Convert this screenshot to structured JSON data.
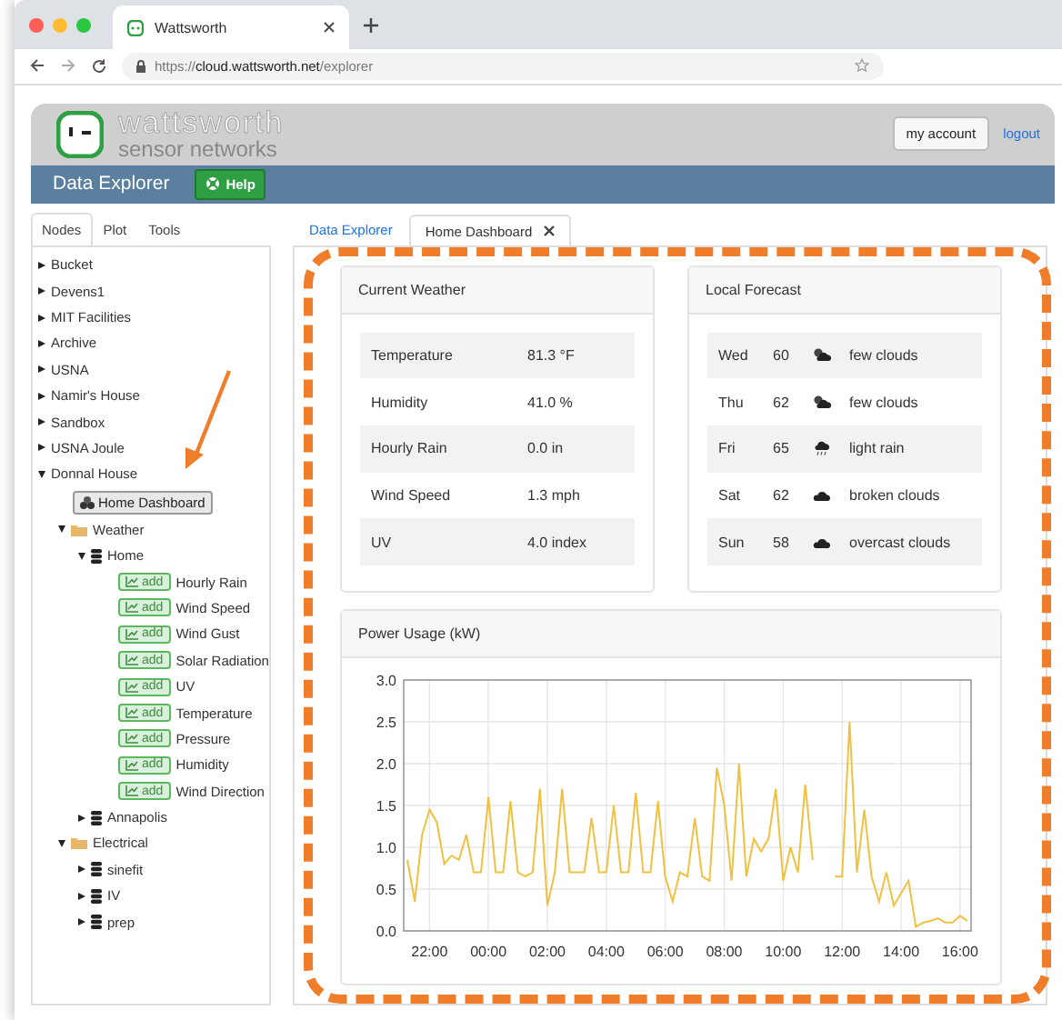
{
  "browser": {
    "tab_title": "Wattsworth",
    "url": "https://**cloud.wattsworth.net**/explorer"
  },
  "header": {
    "brand": "wattsworth",
    "tagline": "sensor networks",
    "account_button": "my account",
    "logout_link": "logout"
  },
  "toolbar": {
    "title": "Data Explorer",
    "help_button": "Help"
  },
  "sidebar": {
    "tabs": [
      {
        "label": "Nodes",
        "selected": true
      },
      {
        "label": "Plot",
        "selected": false
      },
      {
        "label": "Tools",
        "selected": false
      }
    ],
    "nodes": [
      {
        "kind": "group",
        "label": "Bucket",
        "expanded": false
      },
      {
        "kind": "group",
        "label": "Devens1",
        "expanded": false
      },
      {
        "kind": "group",
        "label": "MIT Facilities",
        "expanded": false
      },
      {
        "kind": "group",
        "label": "Archive",
        "expanded": false
      },
      {
        "kind": "group",
        "label": "USNA",
        "expanded": false
      },
      {
        "kind": "group",
        "label": "Namir's House",
        "expanded": false
      },
      {
        "kind": "group",
        "label": "Sandbox",
        "expanded": false
      },
      {
        "kind": "group",
        "label": "USNA Joule",
        "expanded": false
      },
      {
        "kind": "group",
        "label": "Donnal House",
        "expanded": true,
        "children": [
          {
            "kind": "dashboard",
            "label": "Home Dashboard"
          },
          {
            "kind": "folder",
            "label": "Weather",
            "expanded": true,
            "children": [
              {
                "kind": "module",
                "label": "Home",
                "expanded": true,
                "children": [
                  {
                    "kind": "stream",
                    "button": "add",
                    "label": "Hourly Rain"
                  },
                  {
                    "kind": "stream",
                    "button": "add",
                    "label": "Wind Speed"
                  },
                  {
                    "kind": "stream",
                    "button": "add",
                    "label": "Wind Gust"
                  },
                  {
                    "kind": "stream",
                    "button": "add",
                    "label": "Solar Radiation"
                  },
                  {
                    "kind": "stream",
                    "button": "add",
                    "label": "UV"
                  },
                  {
                    "kind": "stream",
                    "button": "add",
                    "label": "Temperature"
                  },
                  {
                    "kind": "stream",
                    "button": "add",
                    "label": "Pressure"
                  },
                  {
                    "kind": "stream",
                    "button": "add",
                    "label": "Humidity"
                  },
                  {
                    "kind": "stream",
                    "button": "add",
                    "label": "Wind Direction"
                  }
                ]
              },
              {
                "kind": "module",
                "label": "Annapolis",
                "expanded": false
              }
            ]
          },
          {
            "kind": "folder",
            "label": "Electrical",
            "expanded": true,
            "children": [
              {
                "kind": "module",
                "label": "sinefit",
                "expanded": false
              },
              {
                "kind": "module",
                "label": "IV",
                "expanded": false
              },
              {
                "kind": "module",
                "label": "prep",
                "expanded": false
              }
            ]
          }
        ]
      }
    ]
  },
  "main_tabs": [
    {
      "label": "Data Explorer",
      "selected": false,
      "closable": false
    },
    {
      "label": "Home Dashboard",
      "selected": true,
      "closable": true
    }
  ],
  "current_weather": {
    "title": "Current Weather",
    "rows": [
      {
        "name": "Temperature",
        "value": "81.3 °F"
      },
      {
        "name": "Humidity",
        "value": "41.0 %"
      },
      {
        "name": "Hourly Rain",
        "value": "0.0 in"
      },
      {
        "name": "Wind Speed",
        "value": "1.3 mph"
      },
      {
        "name": "UV",
        "value": "4.0 index"
      }
    ]
  },
  "local_forecast": {
    "title": "Local Forecast",
    "rows": [
      {
        "day": "Wed",
        "temp": "60",
        "kind": "partly-cloudy",
        "summary": "few clouds"
      },
      {
        "day": "Thu",
        "temp": "62",
        "kind": "partly-cloudy",
        "summary": "few clouds"
      },
      {
        "day": "Fri",
        "temp": "65",
        "kind": "rain",
        "summary": "light rain"
      },
      {
        "day": "Sat",
        "temp": "62",
        "kind": "cloudy",
        "summary": "broken clouds"
      },
      {
        "day": "Sun",
        "temp": "58",
        "kind": "cloudy",
        "summary": "overcast clouds"
      }
    ]
  },
  "power_usage": {
    "title": "Power Usage (kW)",
    "chart_data": {
      "type": "line",
      "grid": true,
      "ylim": [
        0,
        3
      ],
      "categories": [
        null,
        null,
        null,
        "22:00",
        null,
        null,
        null,
        null,
        null,
        null,
        null,
        "00:00",
        null,
        null,
        null,
        null,
        null,
        null,
        null,
        "02:00",
        null,
        null,
        null,
        null,
        null,
        null,
        null,
        "04:00",
        null,
        null,
        null,
        null,
        null,
        null,
        null,
        "06:00",
        null,
        null,
        null,
        null,
        null,
        null,
        null,
        "08:00",
        null,
        null,
        null,
        null,
        null,
        null,
        null,
        "10:00",
        null,
        null,
        null,
        null,
        null,
        null,
        null,
        "12:00",
        null,
        null,
        null,
        null,
        null,
        null,
        null,
        "14:00",
        null,
        null,
        null,
        null,
        null,
        null,
        null,
        "16:00",
        null
      ],
      "yticks": [
        {
          "value": 0,
          "label": "0.0"
        },
        {
          "value": 0.5,
          "label": "0.5"
        },
        {
          "value": 1,
          "label": "1.0"
        },
        {
          "value": 1.5,
          "label": "1.5"
        },
        {
          "value": 2,
          "label": "2.0"
        },
        {
          "value": 2.5,
          "label": "2.5"
        },
        {
          "value": 3,
          "label": "3.0"
        }
      ],
      "series": [
        {
          "color": "#f0c040",
          "values": [
            0.85,
            0.35,
            1.15,
            1.45,
            1.3,
            0.8,
            0.9,
            0.85,
            1.15,
            0.7,
            0.7,
            1.6,
            0.7,
            0.7,
            1.55,
            0.7,
            0.65,
            0.7,
            1.7,
            0.3,
            0.7,
            1.7,
            0.7,
            0.7,
            0.7,
            1.35,
            0.7,
            0.7,
            1.5,
            0.7,
            0.7,
            1.65,
            0.7,
            0.7,
            1.55,
            0.65,
            0.35,
            0.7,
            0.65,
            1.35,
            0.65,
            0.6,
            1.95,
            1.5,
            0.6,
            2.0,
            0.65,
            1.1,
            0.95,
            1.1,
            1.7,
            0.6,
            1.0,
            0.7,
            1.75,
            0.85,
            null,
            null,
            0.65,
            0.65,
            2.5,
            0.7,
            1.45,
            0.65,
            0.35,
            0.7,
            0.3,
            0.45,
            0.6,
            0.05,
            0.1,
            0.12,
            0.15,
            0.1,
            0.1,
            0.18,
            0.12
          ]
        }
      ]
    }
  }
}
